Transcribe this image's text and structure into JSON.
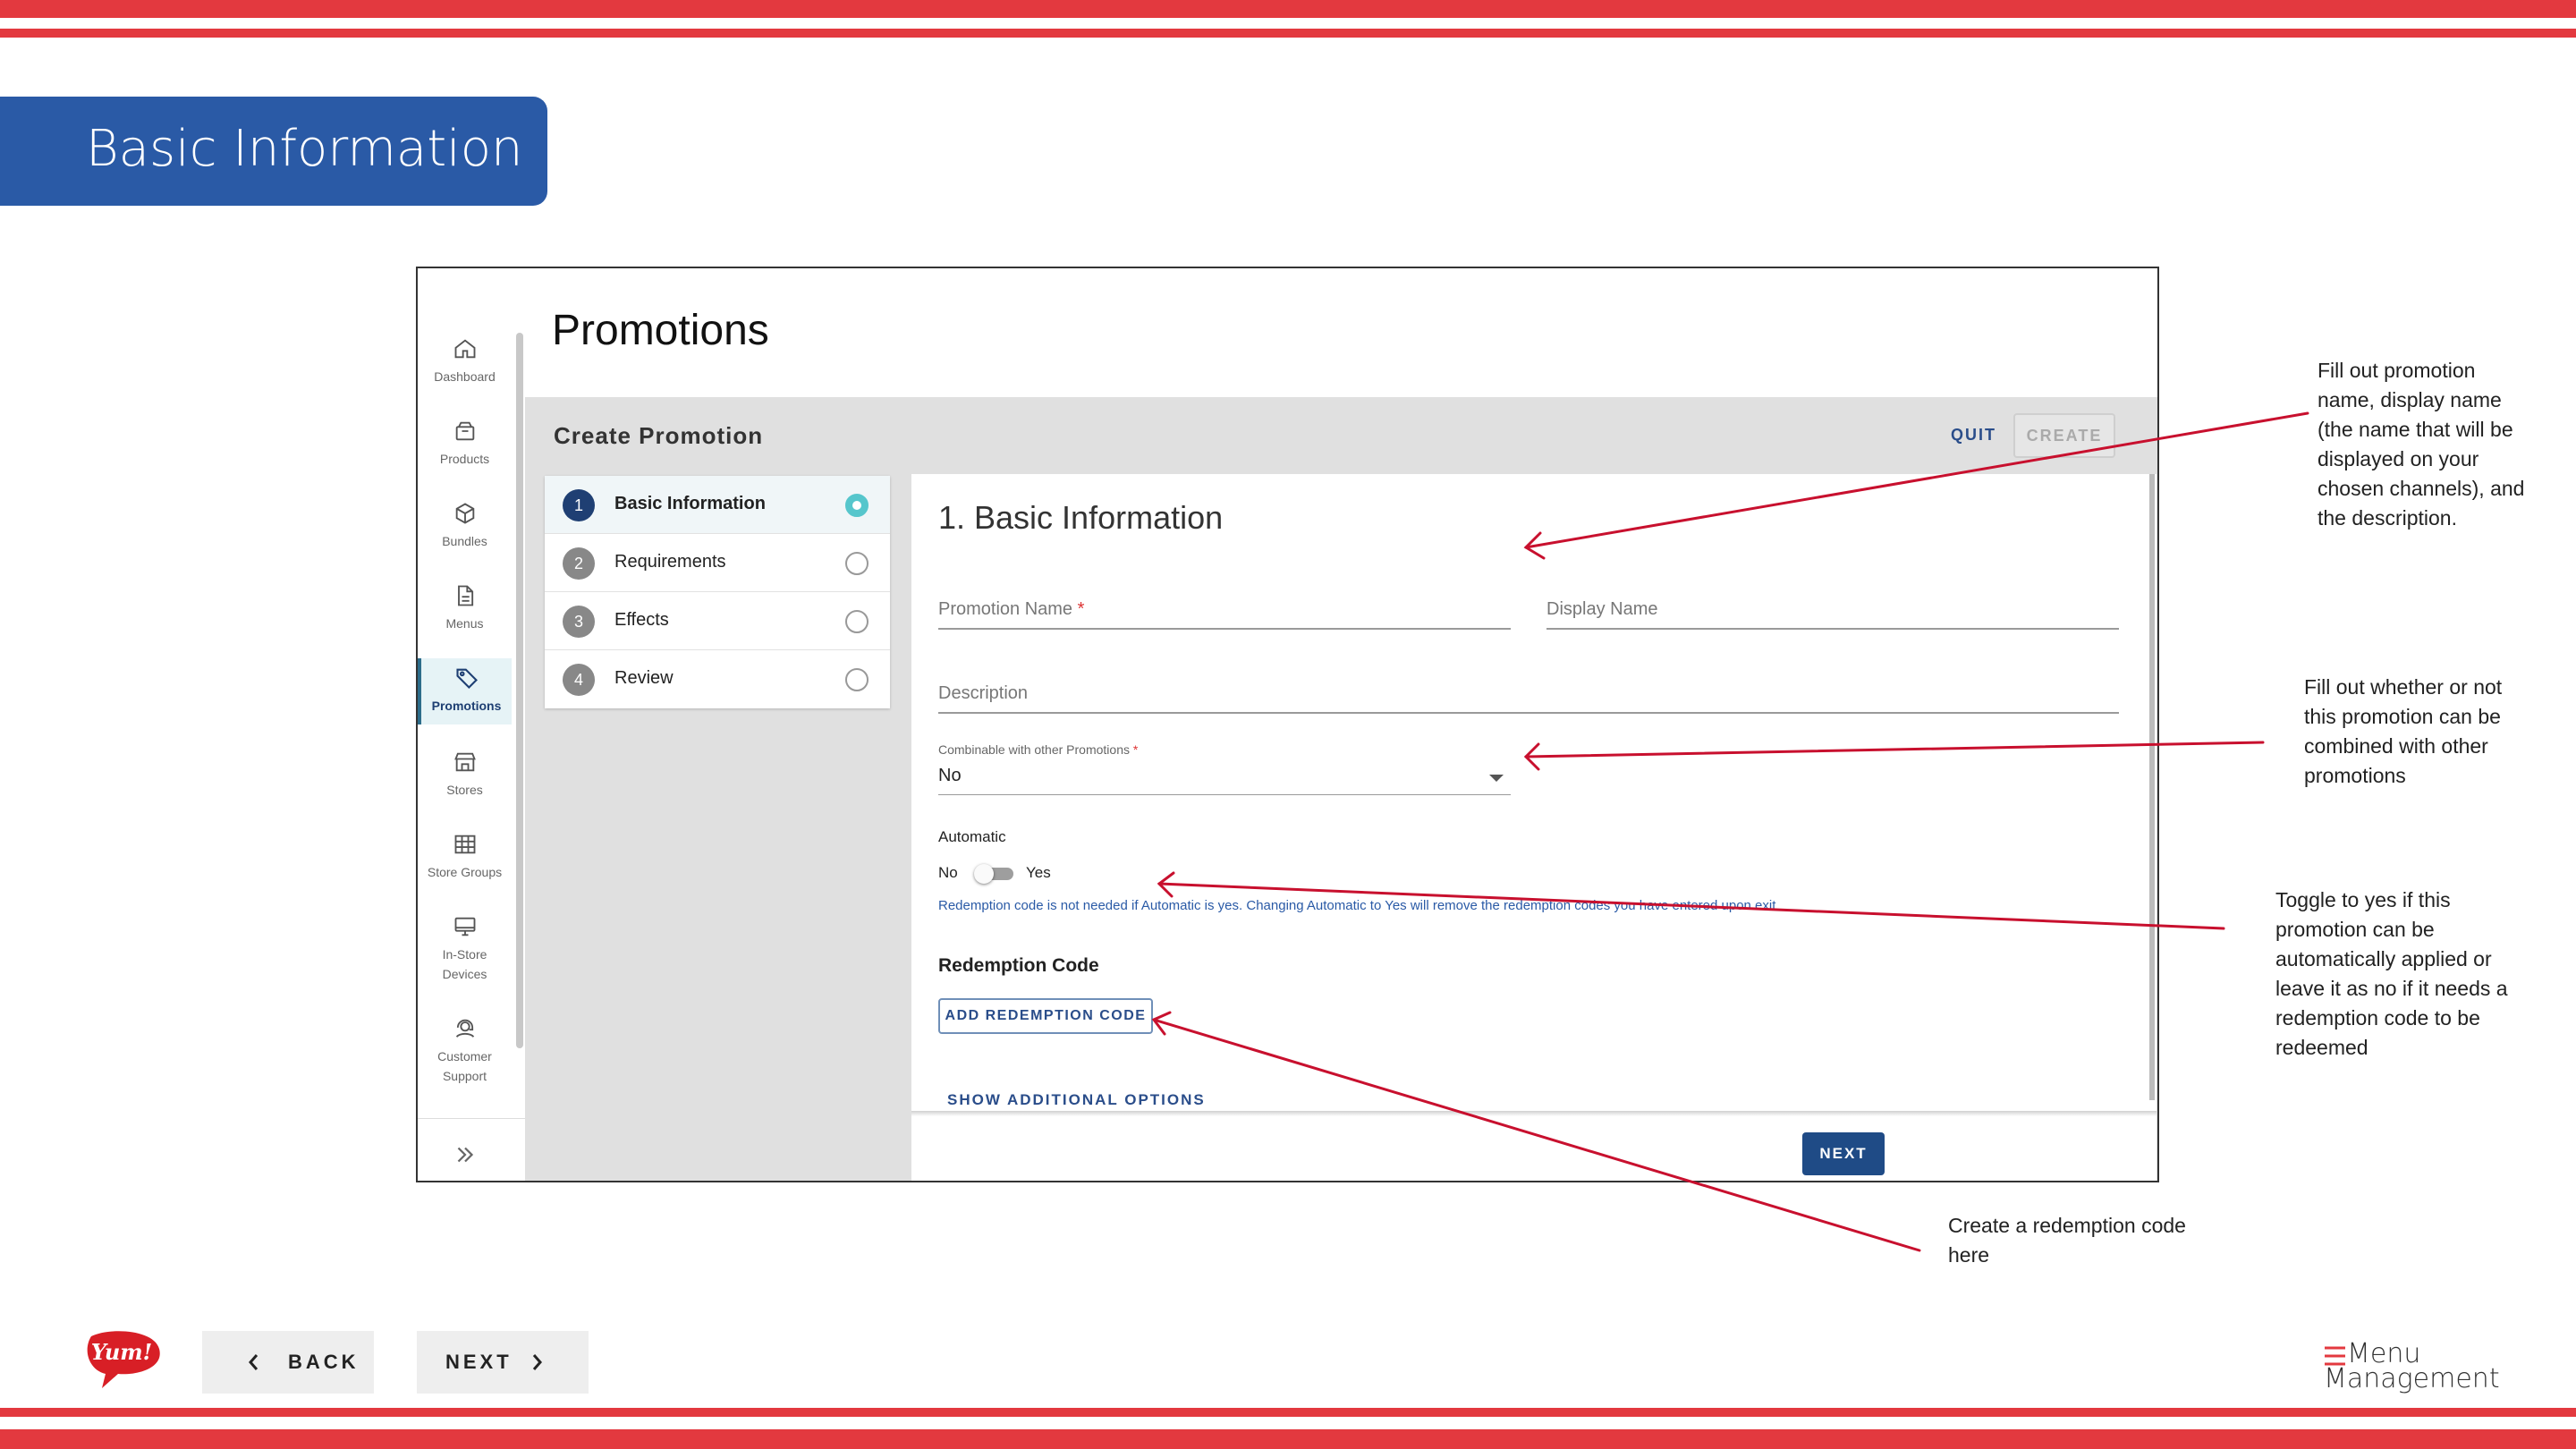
{
  "slide": {
    "title": "Basic Information",
    "back_label": "BACK",
    "next_label": "NEXT",
    "brand_logo_text": "Yum!",
    "footer_logo_line1": "Menu",
    "footer_logo_line2": "Management",
    "accent_color": "#e3393f",
    "banner_color": "#2a5aa6"
  },
  "sidebar": {
    "items": [
      {
        "label": "Dashboard",
        "icon": "home-icon"
      },
      {
        "label": "Products",
        "icon": "box-icon"
      },
      {
        "label": "Bundles",
        "icon": "cube-icon"
      },
      {
        "label": "Menus",
        "icon": "document-icon"
      },
      {
        "label": "Promotions",
        "icon": "tag-icon",
        "active": true
      },
      {
        "label": "Stores",
        "icon": "storefront-icon"
      },
      {
        "label": "Store Groups",
        "icon": "grid-icon"
      },
      {
        "label": "In-Store Devices",
        "icon": "monitor-icon"
      },
      {
        "label": "Customer Support",
        "icon": "headset-icon"
      }
    ]
  },
  "page": {
    "title": "Promotions",
    "section_title": "Create Promotion",
    "quit_label": "QUIT",
    "create_label": "CREATE"
  },
  "steps": [
    {
      "number": "1",
      "label": "Basic Information",
      "active": true
    },
    {
      "number": "2",
      "label": "Requirements"
    },
    {
      "number": "3",
      "label": "Effects"
    },
    {
      "number": "4",
      "label": "Review"
    }
  ],
  "form": {
    "heading": "1. Basic Information",
    "promotion_name_label": "Promotion Name",
    "required_mark": "*",
    "display_name_label": "Display Name",
    "description_label": "Description",
    "combinable_label": "Combinable with other Promotions",
    "combinable_value": "No",
    "automatic_label": "Automatic",
    "toggle_off_label": "No",
    "toggle_on_label": "Yes",
    "automatic_note": "Redemption code is not needed if Automatic is yes. Changing Automatic to Yes will remove the redemption codes you have entered upon exit",
    "redemption_heading": "Redemption Code",
    "add_code_label": "ADD REDEMPTION CODE",
    "show_more_label": "SHOW ADDITIONAL OPTIONS",
    "next_label": "NEXT"
  },
  "annotations": {
    "note1": "Fill out promotion name, display name (the name that will be displayed on your chosen channels), and the description.",
    "note1_lines": [
      "Fill out promotion",
      "name, display name",
      "(the name that will be",
      "displayed on your",
      "chosen channels), and",
      "the description."
    ],
    "note2_lines": [
      "Fill out whether or not",
      "this promotion can be",
      "combined with other",
      "promotions"
    ],
    "note3_lines": [
      "Toggle to yes if this",
      "promotion can be",
      "automatically applied or",
      "leave it as no if it needs a",
      "redemption code to be",
      "redeemed"
    ],
    "note4_lines": [
      "Create a redemption code",
      "here"
    ],
    "arrow_color": "#c8102e"
  }
}
